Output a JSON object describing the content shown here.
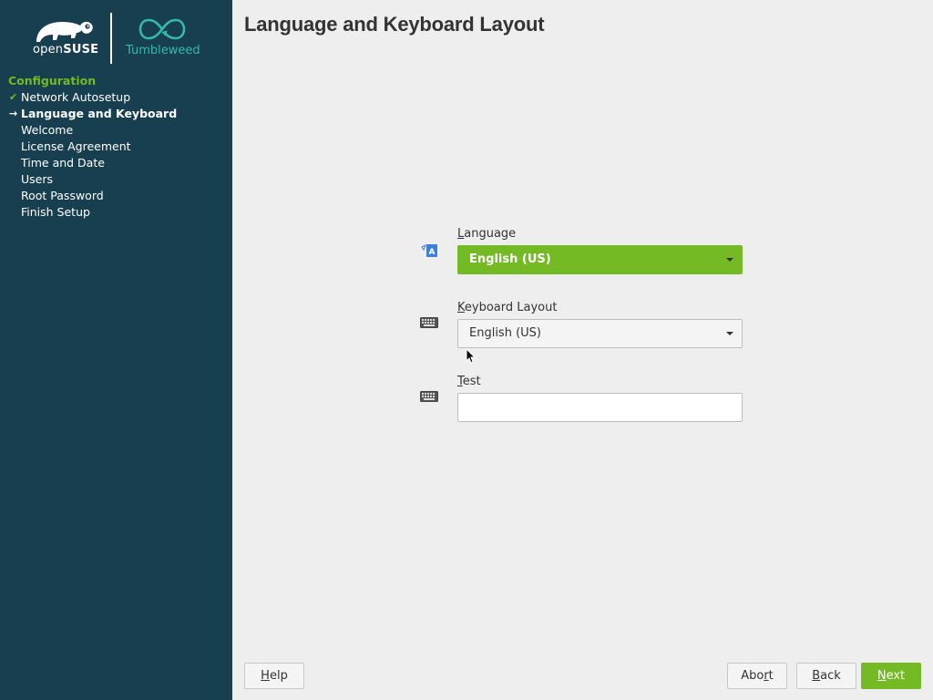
{
  "brand": {
    "open": "open",
    "suse": "SUSE",
    "product": "Tumbleweed"
  },
  "sidebar": {
    "section": "Configuration",
    "steps": [
      {
        "label": "Network Autosetup",
        "state": "done",
        "mark": "✔"
      },
      {
        "label": "Language and Keyboard",
        "state": "current",
        "mark": "→"
      },
      {
        "label": "Welcome",
        "state": "pending",
        "mark": ""
      },
      {
        "label": "License Agreement",
        "state": "pending",
        "mark": ""
      },
      {
        "label": "Time and Date",
        "state": "pending",
        "mark": ""
      },
      {
        "label": "Users",
        "state": "pending",
        "mark": ""
      },
      {
        "label": "Root Password",
        "state": "pending",
        "mark": ""
      },
      {
        "label": "Finish Setup",
        "state": "pending",
        "mark": ""
      }
    ]
  },
  "page": {
    "title": "Language and Keyboard Layout"
  },
  "form": {
    "language": {
      "label_first": "L",
      "label_rest": "anguage",
      "value": "English (US)"
    },
    "keyboard": {
      "label_first": "K",
      "label_rest": "eyboard Layout",
      "value": "English (US)"
    },
    "test": {
      "label_first": "T",
      "label_rest": "est",
      "value": ""
    }
  },
  "buttons": {
    "help": {
      "first": "H",
      "rest": "elp"
    },
    "abort": {
      "pre": "Abo",
      "ul": "r",
      "post": "t"
    },
    "back": {
      "first": "B",
      "rest": "ack"
    },
    "next": {
      "first": "N",
      "rest": "ext"
    }
  },
  "colors": {
    "sidebar_bg": "#173f4f",
    "accent_green": "#73ba25",
    "teal": "#35b9ab"
  }
}
